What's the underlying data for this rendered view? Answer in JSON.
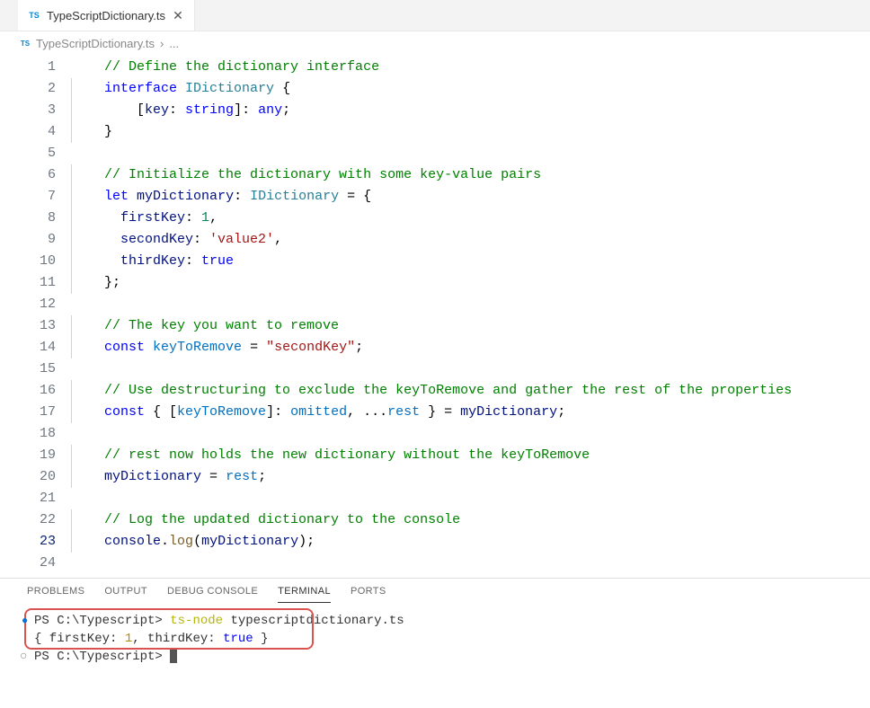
{
  "tab": {
    "icon": "TS",
    "filename": "TypeScriptDictionary.ts"
  },
  "breadcrumb": {
    "icon": "TS",
    "file": "TypeScriptDictionary.ts",
    "sep": "›",
    "more": "..."
  },
  "lines": [
    {
      "n": 1,
      "tokens": [
        [
          "    ",
          ""
        ],
        [
          "// Define the dictionary interface",
          "c-comment"
        ]
      ]
    },
    {
      "n": 2,
      "tokens": [
        [
          "    ",
          ""
        ],
        [
          "interface",
          "c-keyword"
        ],
        [
          " ",
          ""
        ],
        [
          "IDictionary",
          "c-type"
        ],
        [
          " {",
          ""
        ]
      ]
    },
    {
      "n": 3,
      "tokens": [
        [
          "        ",
          ""
        ],
        [
          "[",
          ""
        ],
        [
          "key",
          "c-ident"
        ],
        [
          ": ",
          ""
        ],
        [
          "string",
          "c-keyword"
        ],
        [
          "]: ",
          ""
        ],
        [
          "any",
          "c-keyword"
        ],
        [
          ";",
          ""
        ]
      ]
    },
    {
      "n": 4,
      "tokens": [
        [
          "    ",
          ""
        ],
        [
          "}",
          ""
        ]
      ]
    },
    {
      "n": 5,
      "tokens": [
        [
          "",
          ""
        ]
      ]
    },
    {
      "n": 6,
      "tokens": [
        [
          "    ",
          ""
        ],
        [
          "// Initialize the dictionary with some key-value pairs",
          "c-comment"
        ]
      ]
    },
    {
      "n": 7,
      "tokens": [
        [
          "    ",
          ""
        ],
        [
          "let",
          "c-keyword"
        ],
        [
          " ",
          ""
        ],
        [
          "myDictionary",
          "c-ident"
        ],
        [
          ": ",
          ""
        ],
        [
          "IDictionary",
          "c-type"
        ],
        [
          " = {",
          ""
        ]
      ]
    },
    {
      "n": 8,
      "tokens": [
        [
          "      ",
          ""
        ],
        [
          "firstKey",
          "c-prop"
        ],
        [
          ": ",
          ""
        ],
        [
          "1",
          "c-number"
        ],
        [
          ",",
          ""
        ]
      ]
    },
    {
      "n": 9,
      "tokens": [
        [
          "      ",
          ""
        ],
        [
          "secondKey",
          "c-prop"
        ],
        [
          ": ",
          ""
        ],
        [
          "'value2'",
          "c-string"
        ],
        [
          ",",
          ""
        ]
      ]
    },
    {
      "n": 10,
      "tokens": [
        [
          "      ",
          ""
        ],
        [
          "thirdKey",
          "c-prop"
        ],
        [
          ": ",
          ""
        ],
        [
          "true",
          "c-keyword"
        ]
      ]
    },
    {
      "n": 11,
      "tokens": [
        [
          "    ",
          ""
        ],
        [
          "};",
          ""
        ]
      ]
    },
    {
      "n": 12,
      "tokens": [
        [
          "",
          ""
        ]
      ]
    },
    {
      "n": 13,
      "tokens": [
        [
          "    ",
          ""
        ],
        [
          "// The key you want to remove",
          "c-comment"
        ]
      ]
    },
    {
      "n": 14,
      "tokens": [
        [
          "    ",
          ""
        ],
        [
          "const",
          "c-keyword"
        ],
        [
          " ",
          ""
        ],
        [
          "keyToRemove",
          "c-const"
        ],
        [
          " = ",
          ""
        ],
        [
          "\"secondKey\"",
          "c-string"
        ],
        [
          ";",
          ""
        ]
      ]
    },
    {
      "n": 15,
      "tokens": [
        [
          "",
          ""
        ]
      ]
    },
    {
      "n": 16,
      "tokens": [
        [
          "    ",
          ""
        ],
        [
          "// Use destructuring to exclude the keyToRemove and gather the rest of the properties",
          "c-comment"
        ]
      ]
    },
    {
      "n": 17,
      "tokens": [
        [
          "    ",
          ""
        ],
        [
          "const",
          "c-keyword"
        ],
        [
          " { [",
          ""
        ],
        [
          "keyToRemove",
          "c-const"
        ],
        [
          "]: ",
          ""
        ],
        [
          "omitted",
          "c-const"
        ],
        [
          ", ...",
          ""
        ],
        [
          "rest",
          "c-const"
        ],
        [
          " } = ",
          ""
        ],
        [
          "myDictionary",
          "c-ident"
        ],
        [
          ";",
          ""
        ]
      ]
    },
    {
      "n": 18,
      "tokens": [
        [
          "",
          ""
        ]
      ]
    },
    {
      "n": 19,
      "tokens": [
        [
          "    ",
          ""
        ],
        [
          "// rest now holds the new dictionary without the keyToRemove",
          "c-comment"
        ]
      ]
    },
    {
      "n": 20,
      "tokens": [
        [
          "    ",
          ""
        ],
        [
          "myDictionary",
          "c-ident"
        ],
        [
          " = ",
          ""
        ],
        [
          "rest",
          "c-const"
        ],
        [
          ";",
          ""
        ]
      ]
    },
    {
      "n": 21,
      "tokens": [
        [
          "",
          ""
        ]
      ]
    },
    {
      "n": 22,
      "tokens": [
        [
          "    ",
          ""
        ],
        [
          "// Log the updated dictionary to the console",
          "c-comment"
        ]
      ]
    },
    {
      "n": 23,
      "tokens": [
        [
          "    ",
          ""
        ],
        [
          "console",
          "c-ident"
        ],
        [
          ".",
          ""
        ],
        [
          "log",
          "c-func"
        ],
        [
          "(",
          ""
        ],
        [
          "myDictionary",
          "c-ident"
        ],
        [
          ");",
          ""
        ]
      ]
    },
    {
      "n": 24,
      "tokens": [
        [
          "",
          ""
        ]
      ]
    }
  ],
  "panel": {
    "tabs": [
      "PROBLEMS",
      "OUTPUT",
      "DEBUG CONSOLE",
      "TERMINAL",
      "PORTS"
    ],
    "active": "TERMINAL"
  },
  "terminal": {
    "prompt1": "PS C:\\Typescript> ",
    "cmd": "ts-node",
    "arg": " typescriptdictionary.ts",
    "output": "{ firstKey: ",
    "out_num1": "1",
    "out_mid": ", thirdKey: ",
    "out_bool": "true",
    "out_end": " }",
    "prompt2": "PS C:\\Typescript> "
  }
}
